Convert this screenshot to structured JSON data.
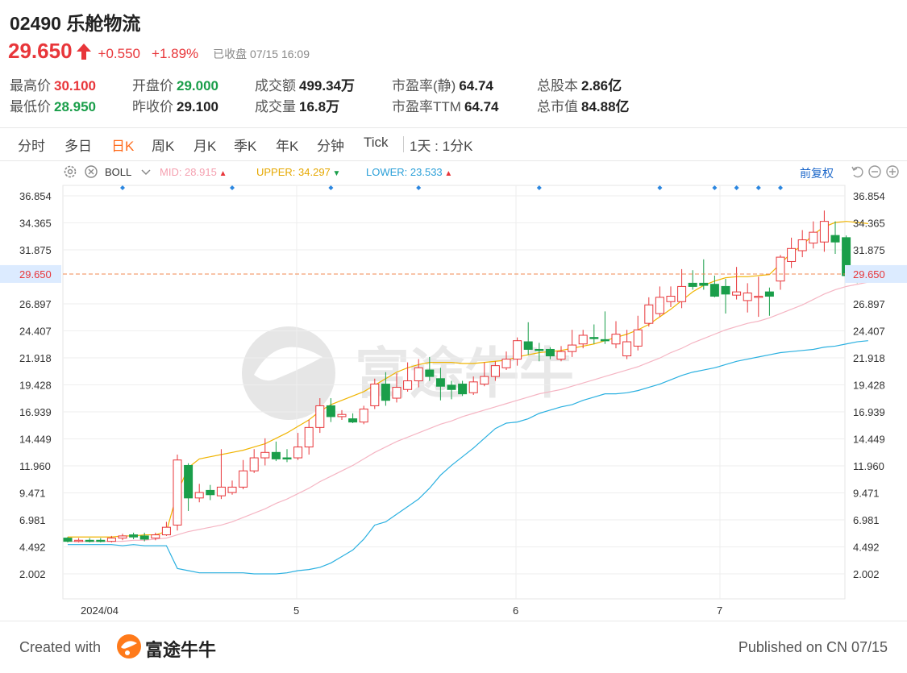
{
  "stock": {
    "code_name": "02490 乐舱物流",
    "price": "29.650",
    "change": "+0.550",
    "change_pct": "+1.89%",
    "status": "已收盘 07/15 16:09"
  },
  "stats": [
    {
      "label": "最高价",
      "value": "30.100",
      "color": "red"
    },
    {
      "label": "开盘价",
      "value": "29.000",
      "color": "green"
    },
    {
      "label": "成交额",
      "value": "499.34万",
      "color": ""
    },
    {
      "label": "市盈率(静)",
      "value": "64.74",
      "color": ""
    },
    {
      "label": "总股本",
      "value": "2.86亿",
      "color": ""
    },
    {
      "label": "最低价",
      "value": "28.950",
      "color": "green"
    },
    {
      "label": "昨收价",
      "value": "29.100",
      "color": ""
    },
    {
      "label": "成交量",
      "value": "16.8万",
      "color": ""
    },
    {
      "label": "市盈率TTM",
      "value": "64.74",
      "color": ""
    },
    {
      "label": "总市值",
      "value": "84.88亿",
      "color": ""
    }
  ],
  "tabs": [
    "分时",
    "多日",
    "日K",
    "周K",
    "月K",
    "季K",
    "年K",
    "分钟",
    "Tick",
    "1天 : 1分K"
  ],
  "active_tab": "日K",
  "indicator": {
    "name": "BOLL",
    "mid": "MID: 28.915",
    "upper": "UPPER: 34.297",
    "lower": "LOWER: 23.533",
    "adjust": "前复权"
  },
  "colors": {
    "up": "#e8363a",
    "down": "#1a9e4a",
    "mid": "#f5b5c3",
    "upper": "#f0b400",
    "lower": "#2ab0e0",
    "accent": "#ff6a1a"
  },
  "chart_data": {
    "type": "candlestick",
    "y_ticks": [
      "36.854",
      "34.365",
      "31.875",
      "29.650",
      "26.897",
      "24.407",
      "21.918",
      "19.428",
      "16.939",
      "14.449",
      "11.960",
      "9.471",
      "6.981",
      "4.492",
      "2.002"
    ],
    "ylim": [
      0.5,
      38.5
    ],
    "current_price": 29.65,
    "current_price_label": "29.650",
    "x_labels": [
      "2024/04",
      "5",
      "6",
      "7"
    ],
    "watermark": "富途牛牛",
    "candles": [
      [
        5.3,
        5.0,
        5.4,
        4.9
      ],
      [
        5.0,
        5.1,
        5.3,
        4.9
      ],
      [
        5.1,
        5.0,
        5.3,
        4.9
      ],
      [
        5.1,
        5.0,
        5.3,
        4.9
      ],
      [
        5.0,
        5.3,
        5.5,
        4.9
      ],
      [
        5.3,
        5.5,
        5.7,
        5.1
      ],
      [
        5.6,
        5.4,
        5.8,
        5.2
      ],
      [
        5.5,
        5.2,
        5.8,
        5.0
      ],
      [
        5.3,
        5.6,
        5.8,
        5.1
      ],
      [
        5.6,
        6.3,
        6.8,
        5.5
      ],
      [
        6.5,
        12.5,
        13.0,
        6.0
      ],
      [
        12.0,
        9.0,
        12.2,
        7.8
      ],
      [
        9.0,
        9.5,
        10.3,
        8.6
      ],
      [
        9.7,
        9.3,
        10.2,
        8.8
      ],
      [
        9.2,
        10.0,
        13.5,
        8.9
      ],
      [
        9.5,
        10.0,
        10.6,
        9.3
      ],
      [
        10.0,
        11.5,
        12.5,
        9.8
      ],
      [
        11.5,
        12.7,
        13.5,
        11.3
      ],
      [
        12.7,
        13.2,
        14.5,
        12.0
      ],
      [
        13.2,
        12.6,
        14.2,
        12.4
      ],
      [
        12.7,
        12.6,
        13.5,
        12.3
      ],
      [
        12.7,
        13.7,
        15.0,
        12.5
      ],
      [
        13.7,
        15.5,
        16.2,
        13.0
      ],
      [
        15.5,
        17.5,
        18.2,
        15.0
      ],
      [
        17.5,
        16.5,
        18.2,
        16.0
      ],
      [
        16.5,
        16.7,
        17.1,
        16.2
      ],
      [
        16.3,
        16.0,
        16.8,
        15.9
      ],
      [
        16.0,
        17.2,
        17.5,
        15.8
      ],
      [
        17.5,
        19.5,
        20.0,
        17.2
      ],
      [
        19.5,
        18.0,
        20.6,
        17.5
      ],
      [
        18.2,
        19.2,
        20.5,
        17.8
      ],
      [
        19.0,
        19.8,
        21.5,
        18.8
      ],
      [
        19.8,
        21.0,
        21.8,
        19.2
      ],
      [
        20.8,
        20.2,
        22.0,
        19.8
      ],
      [
        20.0,
        19.3,
        21.0,
        18.0
      ],
      [
        19.4,
        19.0,
        19.8,
        18.1
      ],
      [
        19.5,
        18.6,
        19.8,
        18.4
      ],
      [
        18.7,
        19.7,
        20.2,
        18.5
      ],
      [
        19.5,
        20.2,
        21.5,
        19.3
      ],
      [
        20.2,
        21.2,
        21.6,
        19.8
      ],
      [
        21.0,
        21.8,
        22.5,
        20.8
      ],
      [
        21.8,
        23.5,
        23.8,
        21.2
      ],
      [
        23.4,
        22.7,
        25.2,
        22.2
      ],
      [
        22.7,
        22.6,
        23.3,
        21.6
      ],
      [
        22.7,
        22.1,
        22.9,
        21.8
      ],
      [
        21.8,
        22.5,
        23.0,
        21.6
      ],
      [
        22.5,
        23.1,
        24.5,
        22.0
      ],
      [
        23.2,
        24.0,
        24.5,
        22.8
      ],
      [
        23.8,
        23.7,
        25.0,
        23.2
      ],
      [
        23.6,
        23.5,
        26.2,
        23.2
      ],
      [
        23.2,
        24.1,
        25.3,
        22.8
      ],
      [
        22.1,
        23.4,
        24.5,
        21.8
      ],
      [
        23.0,
        24.5,
        25.8,
        22.6
      ],
      [
        25.1,
        26.8,
        27.5,
        24.8
      ],
      [
        26.0,
        27.5,
        28.5,
        25.7
      ],
      [
        27.1,
        27.6,
        28.5,
        26.6
      ],
      [
        27.1,
        28.5,
        30.1,
        26.5
      ],
      [
        28.8,
        28.5,
        30.0,
        28.2
      ],
      [
        28.8,
        28.6,
        31.0,
        28.2
      ],
      [
        28.7,
        27.6,
        29.5,
        27.5
      ],
      [
        28.5,
        27.8,
        29.2,
        26.0
      ],
      [
        27.7,
        28.0,
        30.3,
        27.3
      ],
      [
        27.2,
        27.9,
        28.8,
        26.1
      ],
      [
        27.6,
        27.6,
        29.4,
        25.7
      ],
      [
        28.0,
        27.6,
        28.4,
        25.8
      ],
      [
        29.0,
        31.2,
        31.4,
        28.2
      ],
      [
        30.8,
        32.0,
        33.0,
        30.2
      ],
      [
        31.8,
        32.8,
        33.7,
        31.2
      ],
      [
        32.5,
        33.5,
        34.5,
        32.0
      ],
      [
        32.6,
        34.5,
        35.5,
        31.7
      ],
      [
        33.2,
        32.6,
        34.5,
        31.5
      ],
      [
        33.0,
        29.5,
        33.2,
        29.3
      ],
      [
        29.6,
        29.4,
        30.3,
        28.8
      ],
      [
        29.0,
        29.7,
        30.1,
        28.9
      ]
    ],
    "mid": [
      5.0,
      5.0,
      5.0,
      5.0,
      5.0,
      5.0,
      5.1,
      5.1,
      5.2,
      5.3,
      5.6,
      5.9,
      6.1,
      6.3,
      6.5,
      6.8,
      7.2,
      7.6,
      8.0,
      8.5,
      8.9,
      9.4,
      9.9,
      10.5,
      11.0,
      11.5,
      12.0,
      12.6,
      13.2,
      13.7,
      14.2,
      14.6,
      15.0,
      15.4,
      15.8,
      16.1,
      16.5,
      16.8,
      17.1,
      17.4,
      17.7,
      18.0,
      18.3,
      18.6,
      18.8,
      19.0,
      19.3,
      19.6,
      19.9,
      20.2,
      20.5,
      20.8,
      21.1,
      21.5,
      21.9,
      22.4,
      22.8,
      23.3,
      23.7,
      24.1,
      24.5,
      24.8,
      25.1,
      25.3,
      25.6,
      26.0,
      26.4,
      26.8,
      27.3,
      27.8,
      28.2,
      28.5,
      28.7,
      28.9
    ],
    "upper": [
      5.4,
      5.4,
      5.4,
      5.4,
      5.4,
      5.5,
      5.5,
      5.6,
      5.6,
      5.9,
      9.5,
      11.8,
      12.6,
      12.8,
      13.0,
      13.2,
      13.4,
      13.7,
      14.0,
      14.5,
      15.0,
      15.6,
      16.2,
      17.0,
      17.6,
      18.0,
      18.4,
      18.8,
      19.4,
      20.0,
      20.6,
      21.0,
      21.3,
      21.5,
      21.5,
      21.5,
      21.4,
      21.4,
      21.5,
      21.6,
      21.7,
      22.0,
      22.2,
      22.4,
      22.5,
      22.6,
      22.8,
      23.0,
      23.2,
      23.5,
      23.8,
      24.1,
      24.5,
      25.0,
      25.7,
      26.4,
      27.2,
      28.0,
      28.6,
      29.0,
      29.3,
      29.4,
      29.4,
      29.5,
      29.6,
      30.6,
      31.6,
      32.3,
      33.3,
      34.0,
      34.4,
      34.5,
      34.4,
      34.3
    ],
    "lower": [
      4.7,
      4.7,
      4.7,
      4.7,
      4.7,
      4.6,
      4.7,
      4.6,
      4.6,
      4.6,
      2.5,
      2.3,
      2.1,
      2.1,
      2.1,
      2.1,
      2.1,
      2.0,
      2.0,
      2.0,
      2.1,
      2.3,
      2.4,
      2.6,
      3.0,
      3.6,
      4.2,
      5.2,
      6.5,
      6.8,
      7.5,
      8.2,
      8.9,
      9.9,
      11.1,
      12.0,
      12.8,
      13.6,
      14.5,
      15.4,
      15.9,
      16.0,
      16.3,
      16.8,
      17.1,
      17.4,
      17.6,
      18.0,
      18.3,
      18.6,
      18.6,
      18.7,
      18.9,
      19.2,
      19.5,
      19.9,
      20.3,
      20.6,
      20.8,
      21.0,
      21.3,
      21.6,
      21.8,
      22.0,
      22.2,
      22.4,
      22.5,
      22.6,
      22.7,
      22.9,
      23.0,
      23.2,
      23.4,
      23.5
    ],
    "markers": [
      5,
      15,
      24,
      32,
      43,
      54,
      59,
      61,
      63,
      65
    ]
  },
  "footer": {
    "created_with": "Created with",
    "brand": "富途牛牛",
    "published": "Published on CN 07/15"
  }
}
